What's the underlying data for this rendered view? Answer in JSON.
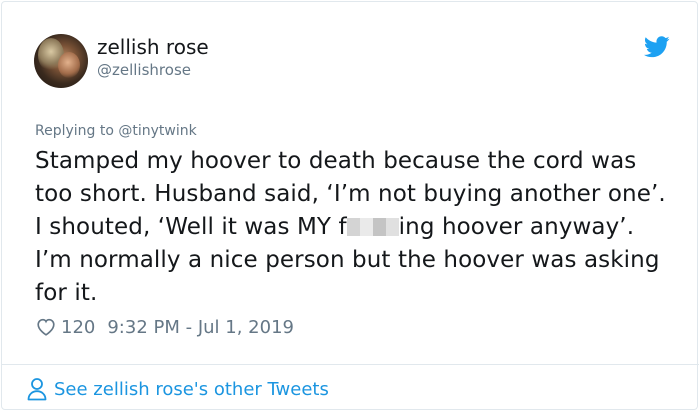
{
  "author": {
    "display_name": "zellish rose",
    "handle": "@zellishrose"
  },
  "tweet": {
    "reply_prefix": "Replying to ",
    "reply_to": "@tinytwink",
    "text_before_censor": "Stamped my hoover to death because the cord was too short. Husband said, ‘I’m not buying another one’. I shouted, ‘Well it was MY f",
    "text_after_censor": "ing hoover anyway’. I’m normally a nice person but the hoover was asking for it.",
    "like_count": "120",
    "timestamp": "9:32 PM - Jul 1, 2019"
  },
  "footer": {
    "link_label": "See zellish rose's other Tweets"
  },
  "icons": {
    "brand": "twitter-bird-icon",
    "like": "heart-icon",
    "profile": "person-icon"
  },
  "colors": {
    "accent": "#1b95e0",
    "text": "#14171a",
    "muted": "#657786",
    "border": "#e1e8ed"
  }
}
